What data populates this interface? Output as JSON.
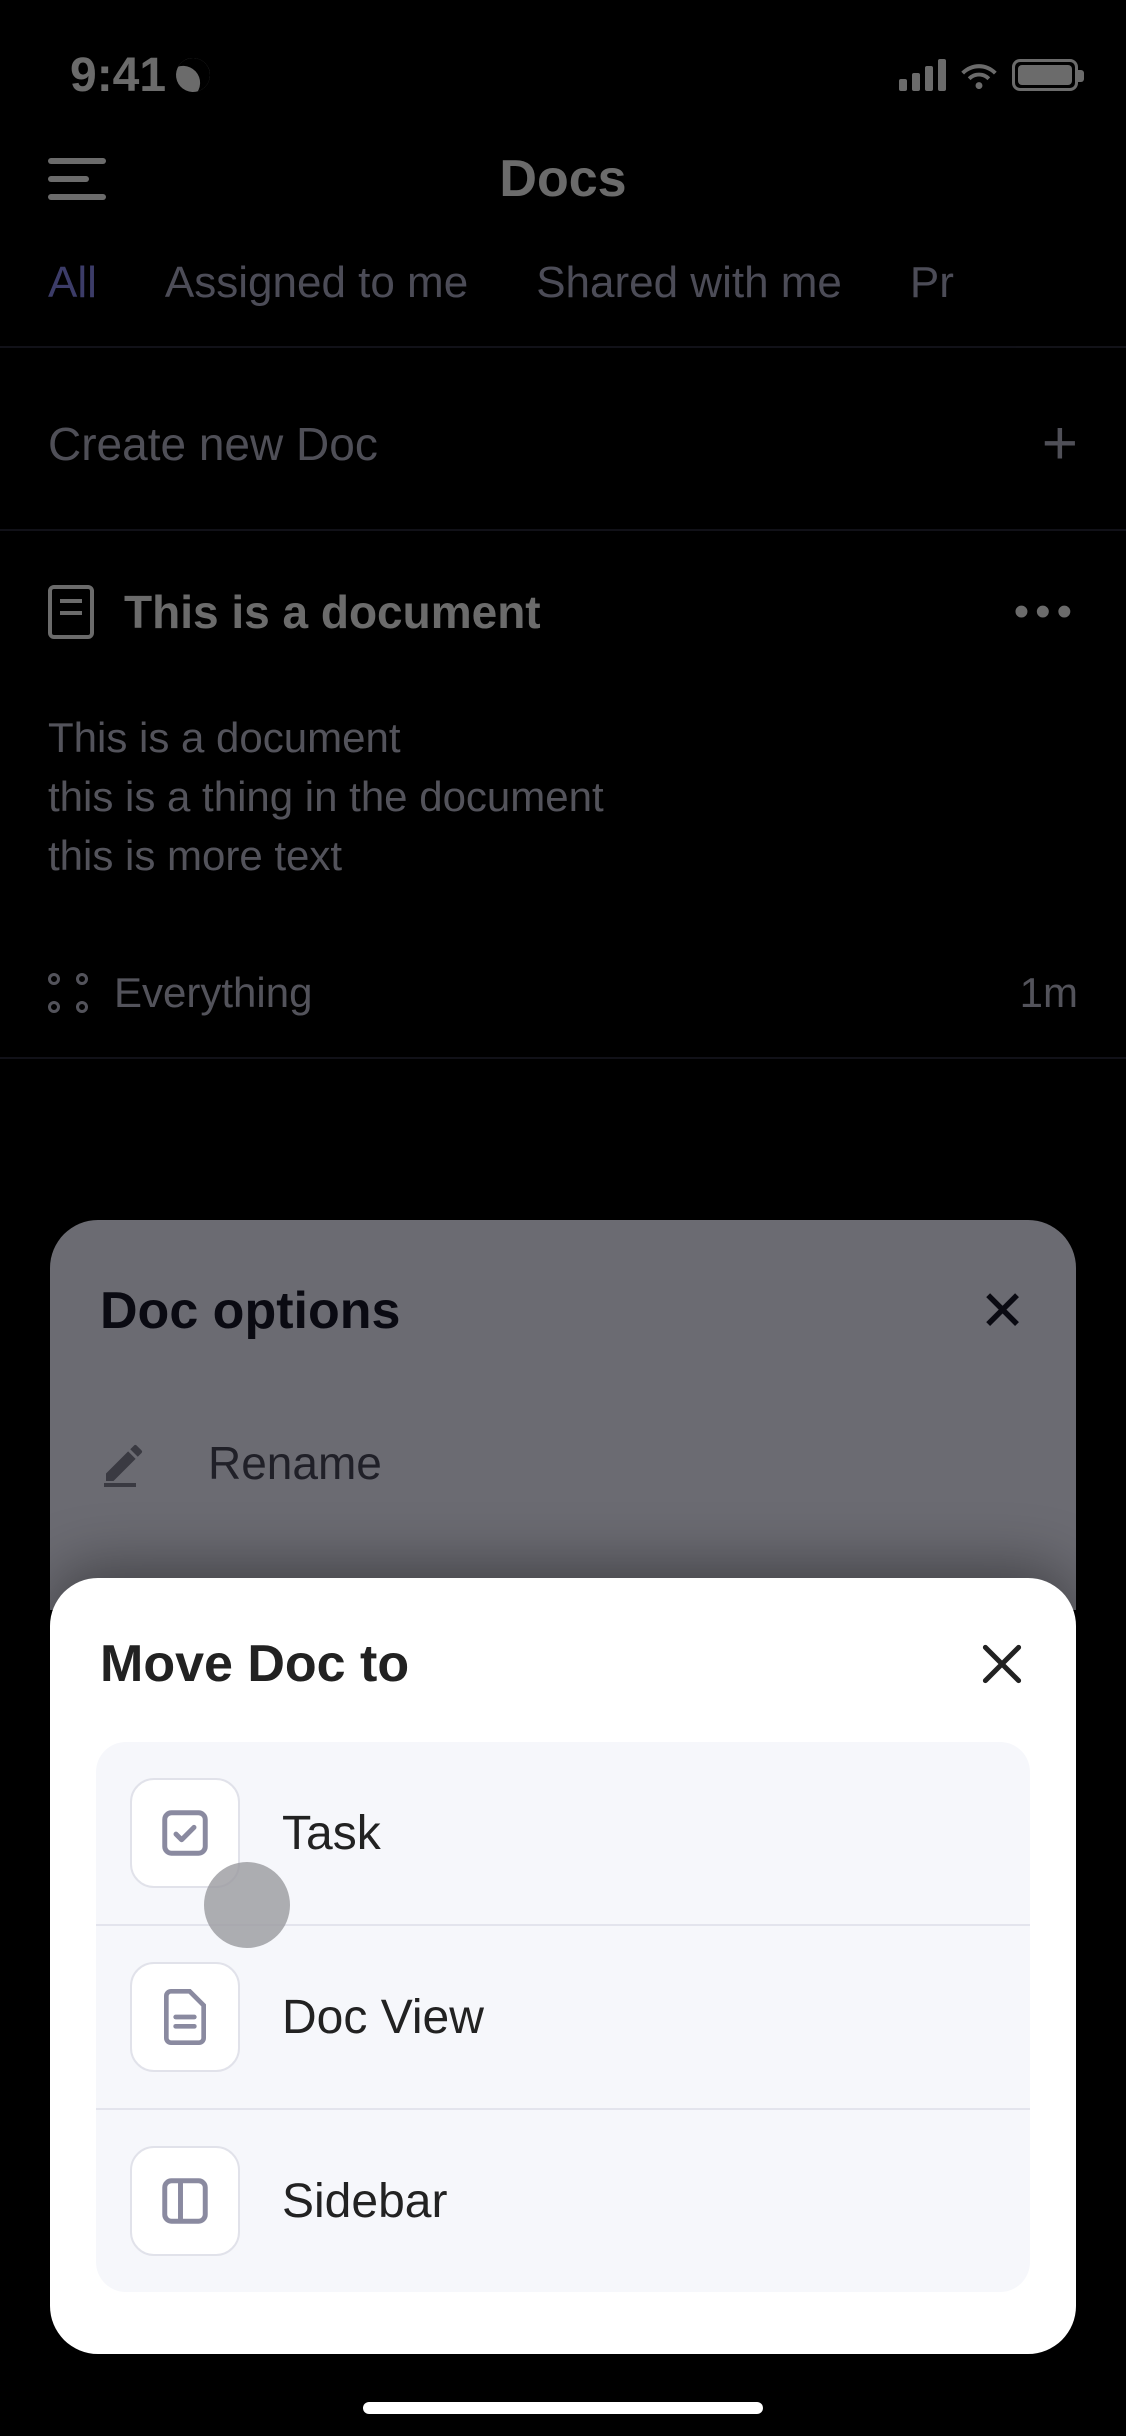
{
  "status": {
    "time": "9:41"
  },
  "header": {
    "title": "Docs"
  },
  "tabs": [
    "All",
    "Assigned to me",
    "Shared with me",
    "Pr"
  ],
  "create": {
    "label": "Create new Doc"
  },
  "doc": {
    "title": "This is a document",
    "body": "This is a document\nthis is a thing in the document\nthis is more text",
    "location": "Everything",
    "age": "1m"
  },
  "docOptions": {
    "title": "Doc options",
    "items": [
      "Rename"
    ]
  },
  "moveSheet": {
    "title": "Move Doc to",
    "items": [
      {
        "label": "Task",
        "icon": "task"
      },
      {
        "label": "Doc View",
        "icon": "doc"
      },
      {
        "label": "Sidebar",
        "icon": "sidebar"
      }
    ]
  }
}
